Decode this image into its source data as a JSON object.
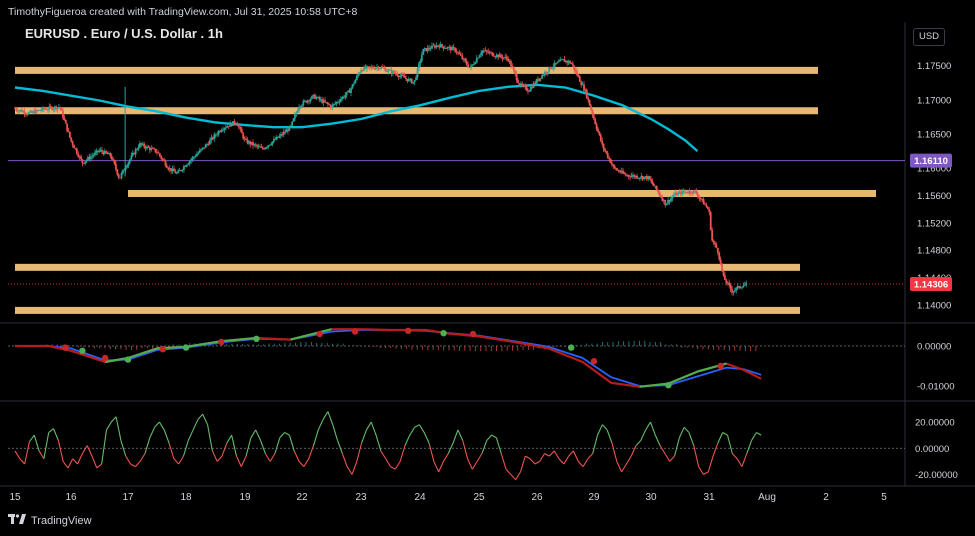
{
  "header": {
    "attribution": "TimothyFigueroa created with TradingView.com, Jul 31, 2025 10:58 UTC+8"
  },
  "symbol": {
    "title": "EURUSD . Euro / U.S. Dollar . 1h",
    "currency": "USD"
  },
  "footer": {
    "brand": "TradingView",
    "logo_icon": "tradingview-logo-icon"
  },
  "colors": {
    "up": "#26a69a",
    "down": "#ef5350",
    "ma": "#00bcd4",
    "zone": "#ffcc80",
    "hline": "#7e57c2",
    "macd_fast": "#2962ff",
    "macd_up": "#4caf50",
    "macd_down": "#b71c1c",
    "osc_up": "#66bb6a",
    "osc_down": "#ef5350",
    "dot_green": "#4caf50",
    "dot_red": "#c62828"
  },
  "chart_data": {
    "type": "candlestick",
    "price_axis": {
      "ticks": [
        "1.17500",
        "1.17000",
        "1.16500",
        "1.16000",
        "1.15600",
        "1.15200",
        "1.14800",
        "1.14400",
        "1.14000"
      ],
      "range": [
        1.1378,
        1.1805
      ]
    },
    "time_axis": {
      "ticks": [
        "15",
        "16",
        "17",
        "18",
        "19",
        "22",
        "23",
        "24",
        "25",
        "26",
        "29",
        "30",
        "31",
        "Aug",
        "2",
        "5"
      ]
    },
    "labels": {
      "hline": "1.16110",
      "last": "1.14306"
    },
    "horizontal_line": 1.1611,
    "last_price": 1.14306,
    "support_resistance_zones": [
      {
        "from": "15",
        "to": "29",
        "price": 1.1743
      },
      {
        "from": "15",
        "to": "29",
        "price": 1.1684
      },
      {
        "from": "17",
        "to": "30",
        "price": 1.1563
      },
      {
        "from": "15",
        "to": "Aug",
        "price": 1.1455
      },
      {
        "from": "15",
        "to": "Aug",
        "price": 1.1392
      }
    ],
    "price_path": [
      [
        15,
        1.1687
      ],
      [
        15.25,
        1.168
      ],
      [
        15.5,
        1.1686
      ],
      [
        15.8,
        1.169
      ],
      [
        16,
        1.164
      ],
      [
        16.2,
        1.1608
      ],
      [
        16.5,
        1.1626
      ],
      [
        16.7,
        1.1618
      ],
      [
        16.85,
        1.1585
      ],
      [
        16.95,
        1.1602
      ],
      [
        17.2,
        1.1635
      ],
      [
        17.5,
        1.1624
      ],
      [
        17.7,
        1.16
      ],
      [
        17.85,
        1.1592
      ],
      [
        18,
        1.1606
      ],
      [
        18.3,
        1.163
      ],
      [
        18.6,
        1.1658
      ],
      [
        18.85,
        1.1668
      ],
      [
        19,
        1.164
      ],
      [
        19.3,
        1.1628
      ],
      [
        19.6,
        1.1646
      ],
      [
        19.8,
        1.166
      ],
      [
        19.95,
        1.1692
      ],
      [
        20.2,
        1.1705
      ],
      [
        20.5,
        1.169
      ],
      [
        20.8,
        1.1712
      ],
      [
        21,
        1.1745
      ],
      [
        21.3,
        1.1748
      ],
      [
        21.6,
        1.1738
      ],
      [
        21.9,
        1.1725
      ],
      [
        22.05,
        1.1772
      ],
      [
        22.3,
        1.178
      ],
      [
        22.6,
        1.1773
      ],
      [
        22.85,
        1.1746
      ],
      [
        23.05,
        1.1772
      ],
      [
        23.3,
        1.1765
      ],
      [
        23.5,
        1.176
      ],
      [
        23.7,
        1.1722
      ],
      [
        23.85,
        1.1714
      ],
      [
        24.05,
        1.1733
      ],
      [
        24.25,
        1.1748
      ],
      [
        24.45,
        1.1758
      ],
      [
        24.6,
        1.1754
      ],
      [
        24.85,
        1.1712
      ],
      [
        25.0,
        1.1672
      ],
      [
        25.15,
        1.1632
      ],
      [
        25.35,
        1.16
      ],
      [
        25.55,
        1.159
      ],
      [
        25.75,
        1.1588
      ],
      [
        25.95,
        1.1586
      ],
      [
        26.1,
        1.1568
      ],
      [
        26.25,
        1.1548
      ],
      [
        26.4,
        1.1561
      ],
      [
        26.55,
        1.1565
      ],
      [
        26.75,
        1.1566
      ],
      [
        26.85,
        1.1556
      ],
      [
        27.0,
        1.1538
      ],
      [
        27.05,
        1.1495
      ],
      [
        27.15,
        1.148
      ],
      [
        27.25,
        1.144
      ],
      [
        27.4,
        1.142
      ],
      [
        27.55,
        1.1428
      ],
      [
        27.65,
        1.143
      ]
    ],
    "moving_average": [
      [
        15,
        1.1718
      ],
      [
        15.5,
        1.1713
      ],
      [
        16,
        1.1706
      ],
      [
        16.5,
        1.1699
      ],
      [
        17,
        1.169
      ],
      [
        17.5,
        1.1683
      ],
      [
        18,
        1.1674
      ],
      [
        18.5,
        1.1667
      ],
      [
        19,
        1.1663
      ],
      [
        19.5,
        1.166
      ],
      [
        20,
        1.166
      ],
      [
        20.5,
        1.1665
      ],
      [
        21,
        1.1672
      ],
      [
        21.5,
        1.1683
      ],
      [
        22,
        1.1692
      ],
      [
        22.5,
        1.1703
      ],
      [
        23,
        1.1713
      ],
      [
        23.5,
        1.1719
      ],
      [
        24,
        1.1722
      ],
      [
        24.5,
        1.1718
      ],
      [
        25,
        1.1706
      ],
      [
        25.5,
        1.1692
      ],
      [
        26,
        1.1672
      ],
      [
        26.3,
        1.1657
      ],
      [
        26.6,
        1.164
      ],
      [
        26.8,
        1.1625
      ]
    ],
    "macd": {
      "ticks": [
        "0.00000",
        "-0.01000"
      ],
      "range": [
        -0.0135,
        0.0045
      ],
      "fast": [
        [
          15,
          0.0
        ],
        [
          15.6,
          0.0
        ],
        [
          16,
          -0.0012
        ],
        [
          16.6,
          -0.004
        ],
        [
          17,
          -0.003
        ],
        [
          17.5,
          -0.0006
        ],
        [
          18,
          -0.0002
        ],
        [
          18.6,
          0.0012
        ],
        [
          19.2,
          0.002
        ],
        [
          19.8,
          0.0016
        ],
        [
          20.5,
          0.0042
        ],
        [
          21,
          0.0042
        ],
        [
          21.5,
          0.004
        ],
        [
          22.1,
          0.004
        ],
        [
          22.5,
          0.0031
        ],
        [
          23,
          0.0024
        ],
        [
          23.6,
          0.001
        ],
        [
          24.2,
          -0.0006
        ],
        [
          24.8,
          -0.004
        ],
        [
          25.3,
          -0.0092
        ],
        [
          25.8,
          -0.0102
        ],
        [
          26.3,
          -0.0094
        ],
        [
          26.8,
          -0.0064
        ],
        [
          27.3,
          -0.0044
        ],
        [
          27.6,
          -0.006
        ],
        [
          27.9,
          -0.0082
        ]
      ],
      "signal": [
        [
          15,
          0.0
        ],
        [
          15.6,
          0.0
        ],
        [
          16,
          -0.0006
        ],
        [
          16.6,
          -0.0036
        ],
        [
          17,
          -0.0034
        ],
        [
          17.5,
          -0.001
        ],
        [
          18,
          -0.0004
        ],
        [
          18.6,
          0.0009
        ],
        [
          19.2,
          0.0018
        ],
        [
          19.8,
          0.0016
        ],
        [
          20.5,
          0.0036
        ],
        [
          21,
          0.004
        ],
        [
          21.5,
          0.004
        ],
        [
          22.1,
          0.0038
        ],
        [
          22.5,
          0.0032
        ],
        [
          23,
          0.0026
        ],
        [
          23.6,
          0.0012
        ],
        [
          24.2,
          -0.0002
        ],
        [
          24.8,
          -0.003
        ],
        [
          25.3,
          -0.0078
        ],
        [
          25.8,
          -0.01
        ],
        [
          26.3,
          -0.0098
        ],
        [
          26.8,
          -0.0076
        ],
        [
          27.3,
          -0.0054
        ],
        [
          27.6,
          -0.0058
        ],
        [
          27.9,
          -0.0072
        ]
      ],
      "histogram": [
        0.0002,
        0.0003,
        0.0004,
        0.0002,
        -0.0003,
        -0.0006,
        -0.0008,
        -0.001,
        -0.0006,
        -0.0004,
        0.0004,
        0.0007,
        0.0009,
        0.0006,
        0.0005,
        0.0004,
        0.0006,
        0.0008,
        0.001,
        0.0008,
        0.0006,
        0.0002,
        -0.0002,
        -0.0005,
        -0.0007,
        -0.0009,
        -0.001,
        -0.0011,
        -0.0012,
        -0.0013,
        -0.0013,
        -0.0012,
        -0.001,
        -0.0007,
        -0.0002,
        0.0003,
        0.0006,
        0.001,
        0.0012,
        0.0013,
        0.001,
        0.0004,
        -0.0004,
        -0.0008,
        -0.001,
        -0.0012,
        -0.0013
      ],
      "dots": [
        [
          15.9,
          -0.0004,
          "red"
        ],
        [
          16.2,
          -0.0012,
          "green"
        ],
        [
          16.6,
          -0.003,
          "red"
        ],
        [
          17.0,
          -0.0034,
          "green"
        ],
        [
          17.6,
          -0.0008,
          "red"
        ],
        [
          18.0,
          -0.0004,
          "green"
        ],
        [
          18.6,
          0.001,
          "red"
        ],
        [
          19.2,
          0.0018,
          "green"
        ],
        [
          20.3,
          0.003,
          "red"
        ],
        [
          20.9,
          0.0036,
          "red"
        ],
        [
          21.8,
          0.0038,
          "red"
        ],
        [
          22.4,
          0.0032,
          "green"
        ],
        [
          22.9,
          0.003,
          "red"
        ],
        [
          24.6,
          -0.0004,
          "green"
        ],
        [
          25.0,
          -0.0038,
          "red"
        ],
        [
          26.3,
          -0.0098,
          "green"
        ],
        [
          27.2,
          -0.005,
          "red"
        ]
      ]
    },
    "oscillator": {
      "ticks": [
        "20.00000",
        "0.00000",
        "-20.00000"
      ],
      "range": [
        -28,
        33
      ],
      "values": [
        -2,
        -8,
        -12,
        5,
        10,
        -2,
        -8,
        12,
        15,
        6,
        -10,
        -15,
        -8,
        -12,
        -4,
        2,
        -6,
        -15,
        -12,
        14,
        20,
        24,
        6,
        -6,
        -12,
        -14,
        -10,
        -4,
        8,
        16,
        20,
        14,
        4,
        -8,
        -12,
        -6,
        6,
        14,
        22,
        26,
        18,
        -2,
        -10,
        -6,
        4,
        10,
        -6,
        -14,
        -6,
        8,
        14,
        6,
        -4,
        -10,
        -4,
        8,
        12,
        10,
        -2,
        -10,
        -14,
        -8,
        2,
        14,
        22,
        28,
        18,
        6,
        -4,
        -14,
        -20,
        -10,
        4,
        14,
        20,
        10,
        -2,
        -8,
        -14,
        -16,
        -10,
        2,
        10,
        16,
        18,
        12,
        4,
        -10,
        -18,
        -10,
        -4,
        4,
        14,
        6,
        -8,
        -16,
        -10,
        -4,
        6,
        10,
        8,
        -4,
        -16,
        -20,
        -24,
        -18,
        -6,
        -8,
        -12,
        -10,
        -4,
        -6,
        -2,
        -8,
        -12,
        -6,
        -2,
        -10,
        -14,
        -8,
        -4,
        10,
        18,
        14,
        4,
        -10,
        -18,
        -12,
        -6,
        2,
        6,
        14,
        20,
        10,
        2,
        -4,
        -10,
        -6,
        8,
        16,
        12,
        2,
        -14,
        -20,
        -18,
        -6,
        4,
        12,
        10,
        -4,
        -8,
        -14,
        -4,
        6,
        12,
        10
      ]
    }
  }
}
